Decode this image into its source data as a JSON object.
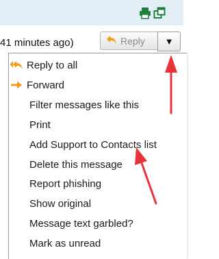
{
  "header": {
    "print_icon": "print-icon",
    "new_window_icon": "new-window-icon"
  },
  "message": {
    "timestamp": "41 minutes ago)"
  },
  "reply_button": {
    "label": "Reply",
    "icon": "reply-arrow-icon",
    "dropdown_symbol": "▼"
  },
  "menu": {
    "items": [
      {
        "label": "Reply to all",
        "icon": "reply-all-icon"
      },
      {
        "label": "Forward",
        "icon": "forward-arrow-icon"
      },
      {
        "label": "Filter messages like this"
      },
      {
        "label": "Print"
      },
      {
        "label": "Add Support to Contacts list"
      },
      {
        "label": "Delete this message"
      },
      {
        "label": "Report phishing"
      },
      {
        "label": "Show original"
      },
      {
        "label": "Message text garbled?"
      },
      {
        "label": "Mark as unread"
      }
    ]
  },
  "colors": {
    "header_bg": "#e3edf6",
    "icon_green": "#1d7f3a",
    "reply_orange": "#f39c1c",
    "annotation_red": "#e8333a"
  }
}
